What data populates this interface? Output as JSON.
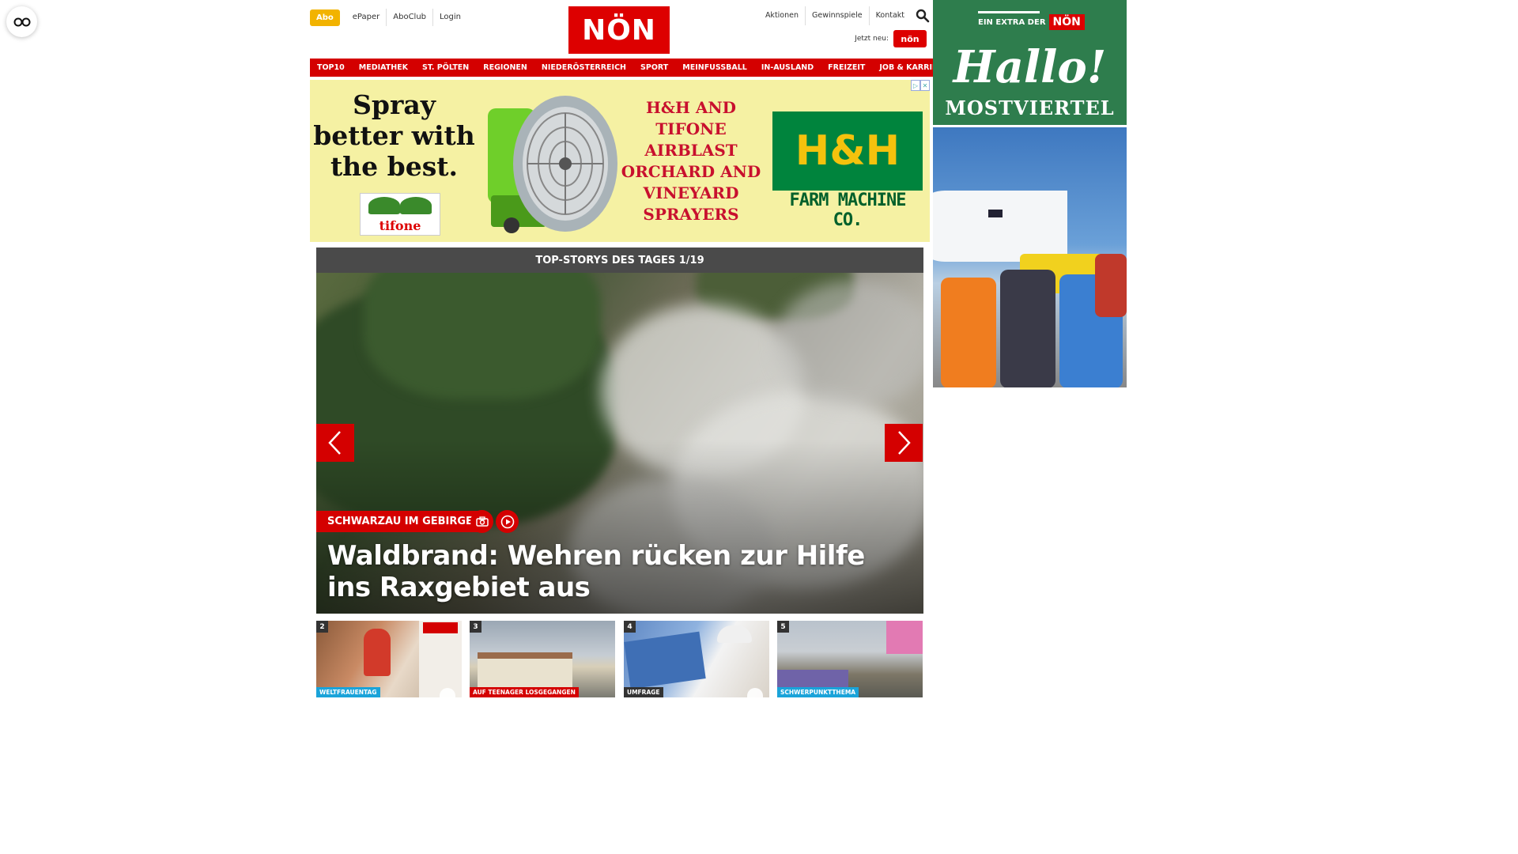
{
  "topbar": {
    "abo_label": "Abo",
    "links": [
      "ePaper",
      "AboClub",
      "Login"
    ]
  },
  "logo": {
    "text": "NÖN"
  },
  "utility_nav": {
    "links": [
      "Aktionen",
      "Gewinnspiele",
      "Kontakt"
    ],
    "jetzt_label": "Jetzt neu:",
    "jetzt_badge": "nön"
  },
  "main_nav": {
    "items": [
      "TOP10",
      "MEDIATHEK",
      "ST. PÖLTEN",
      "REGIONEN",
      "NIEDERÖSTERREICH",
      "SPORT",
      "MEINFUSSBALL",
      "IN-AUSLAND",
      "FREIZEIT",
      "JOB & KARRIERE"
    ]
  },
  "ad_banner": {
    "slogan": "Spray better with the best.",
    "tifone_logo": "tifone",
    "product_text": "H&H AND TIFONE AIRBLAST ORCHARD AND VINEYARD SPRAYERS",
    "brand_mark": "H&H",
    "brand_name": "FARM MACHINE CO."
  },
  "top_stories": {
    "header": "TOP-STORYS DES TAGES 1/19",
    "hero": {
      "kicker": "SCHWARZAU IM GEBIRGE",
      "headline": "Waldbrand: Wehren rücken zur Hilfe ins Raxgebiet aus"
    },
    "thumbnails": [
      {
        "number": "2",
        "tag": "WELTFRAUENTAG",
        "tag_color": "#1aa3d9"
      },
      {
        "number": "3",
        "tag": "AUF TEENAGER LOSGEGANGEN",
        "tag_color": "#d40000"
      },
      {
        "number": "4",
        "tag": "UMFRAGE",
        "tag_color": "#333333"
      },
      {
        "number": "5",
        "tag": "SCHWERPUNKTTHEMA",
        "tag_color": "#1aa3d9"
      }
    ]
  },
  "side_ad": {
    "extra_label": "EIN EXTRA DER",
    "extra_logo": "NÖN",
    "hallo": "Hallo!",
    "region": "MOSTVIERTEL"
  },
  "colors": {
    "brand_red": "#d40000",
    "abo_yellow": "#f2b300",
    "side_ad_green": "#2e7d4d"
  }
}
